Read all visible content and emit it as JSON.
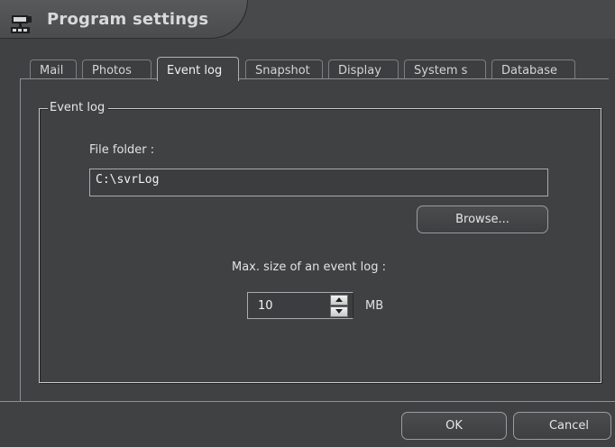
{
  "window": {
    "title": "Program settings",
    "icon": "camera-settings-icon"
  },
  "tabs": [
    {
      "label": "Mail",
      "active": false
    },
    {
      "label": "Photos",
      "active": false
    },
    {
      "label": "Event log",
      "active": true
    },
    {
      "label": "Snapshot",
      "active": false
    },
    {
      "label": "Display",
      "active": false
    },
    {
      "label": "System s",
      "active": false
    },
    {
      "label": "Database",
      "active": false
    }
  ],
  "event_log": {
    "group_title": "Event log",
    "folder_label": "File folder :",
    "folder_value": "C:\\svrLog",
    "browse_label": "Browse...",
    "max_size_label": "Max. size of an event log :",
    "max_size_value": "10",
    "max_size_unit": "MB"
  },
  "footer": {
    "ok_label": "OK",
    "cancel_label": "Cancel"
  },
  "colors": {
    "background": "#3f4143",
    "border": "#8d8f92",
    "text": "#e6e6e6"
  }
}
